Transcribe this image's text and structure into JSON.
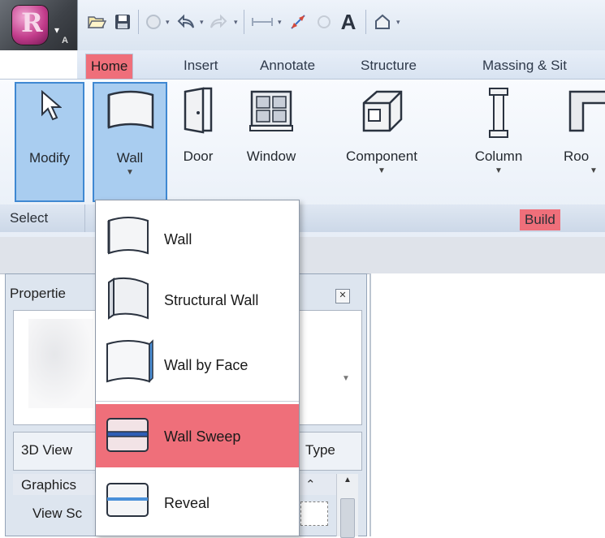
{
  "qat": {
    "app_logo_letter": "R",
    "app_logo_sub": "A",
    "text_tool_glyph": "A",
    "icons": [
      "open-icon",
      "save-icon",
      "sync-icon",
      "undo-icon",
      "redo-icon",
      "measure-icon",
      "dimension-icon",
      "tag-icon",
      "text-icon",
      "3d-view-icon"
    ]
  },
  "ribbon": {
    "tabs": [
      "Home",
      "Insert",
      "Annotate",
      "Structure",
      "Massing & Sit"
    ],
    "active_tab": "Home",
    "buttons": {
      "modify": "Modify",
      "wall": "Wall",
      "door": "Door",
      "window": "Window",
      "component": "Component",
      "column": "Column",
      "roof": "Roo"
    },
    "panels": {
      "select": "Select",
      "build": "Build"
    }
  },
  "properties": {
    "title": "Propertie",
    "type_left": "3D View",
    "type_right": "Type",
    "group": "Graphics",
    "row_label": "View Sc"
  },
  "wall_menu": {
    "items": [
      {
        "label": "Wall",
        "icon": "wall-icon"
      },
      {
        "label": "Structural Wall",
        "icon": "structural-wall-icon"
      },
      {
        "label": "Wall by Face",
        "icon": "wall-by-face-icon"
      },
      {
        "label": "Wall Sweep",
        "icon": "wall-sweep-icon",
        "highlighted": true
      },
      {
        "label": "Reveal",
        "icon": "reveal-icon"
      }
    ]
  },
  "colors": {
    "highlight": "#ef6f7a",
    "selected_button": "#a9cdf0",
    "selected_border": "#3f88d2",
    "sweep_line": "#2f5db5",
    "reveal_line": "#4a90d9"
  }
}
